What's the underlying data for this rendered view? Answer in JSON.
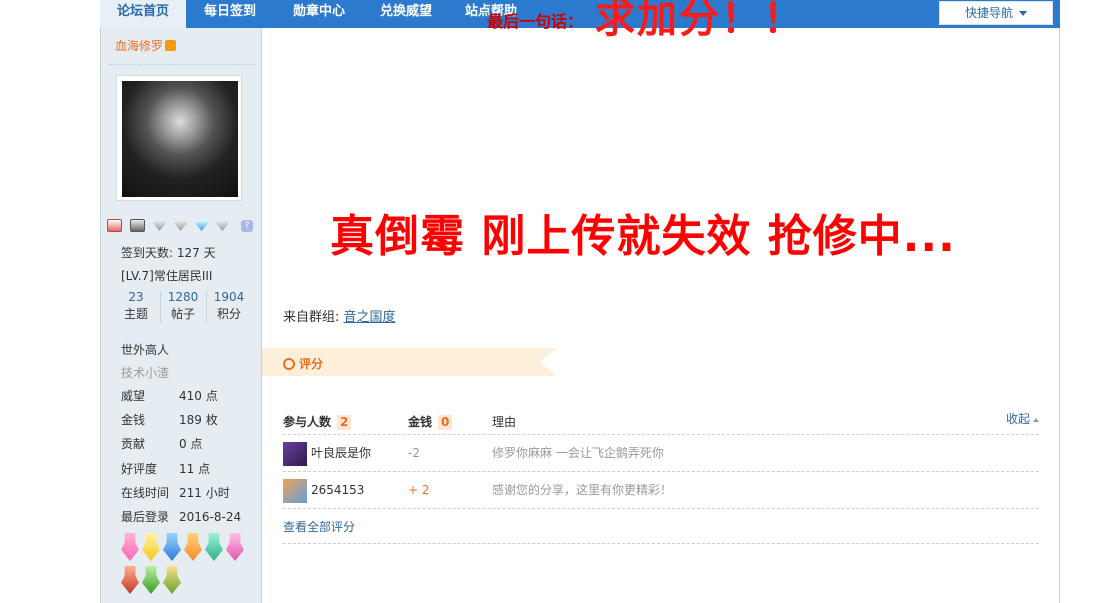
{
  "nav": {
    "items": [
      {
        "label": "论坛首页",
        "active": true
      },
      {
        "label": "每日签到",
        "active": false
      },
      {
        "label": "勋章中心",
        "active": false
      },
      {
        "label": "兑换威望",
        "active": false
      },
      {
        "label": "站点帮助",
        "active": false
      }
    ],
    "quick_nav": "快捷导航"
  },
  "sidebar": {
    "username": "血海修罗",
    "checkin": "签到天数: 127 天",
    "level": "[LV.7]常住居民III",
    "stats": [
      {
        "value": "23",
        "label": "主题"
      },
      {
        "value": "1280",
        "label": "帖子"
      },
      {
        "value": "1904",
        "label": "积分"
      }
    ],
    "title": "世外高人",
    "subtitle": "技术小渣",
    "fields": [
      {
        "key": "威望",
        "value": "410 点"
      },
      {
        "key": "金钱",
        "value": "189 枚"
      },
      {
        "key": "贡献",
        "value": "0 点"
      },
      {
        "key": "好评度",
        "value": "11 点"
      },
      {
        "key": "在线时间",
        "value": "211 小时"
      },
      {
        "key": "最后登录",
        "value": "2016-8-24"
      }
    ]
  },
  "content": {
    "last_words_label": "最后一句话：",
    "last_words_text": "求加分！！",
    "headline": "真倒霉 刚上传就失效  抢修中...",
    "group_prefix": "来自群组: ",
    "group_name": "音之国度"
  },
  "rating": {
    "section_label": "评分",
    "headers": {
      "participants": "参与人数",
      "participants_count": "2",
      "money": "金钱",
      "money_total": "0",
      "reason": "理由",
      "collapse": "收起"
    },
    "rows": [
      {
        "user": "叶良辰是你",
        "amount": "-2",
        "reason": "修罗你麻麻 一会让飞企鹅弄死你"
      },
      {
        "user": "2654153",
        "amount": "+ 2",
        "reason": "感谢您的分享，这里有你更精彩！"
      }
    ],
    "view_all": "查看全部评分"
  },
  "colors": {
    "nav_blue": "#2b7acd",
    "sidebar_bg": "#e5edf2",
    "accent_orange": "#f26c1f",
    "headline_red": "#ff0000",
    "link_blue": "#336699"
  }
}
